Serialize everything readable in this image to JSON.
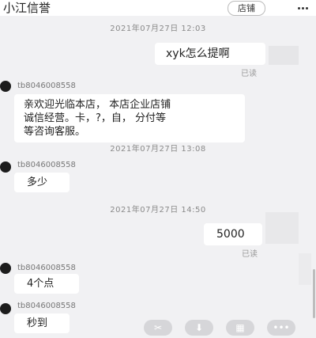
{
  "header": {
    "title": "小江信誉",
    "shop_label": "店铺",
    "more_icon": "more-dots-icon"
  },
  "messages": [
    {
      "type": "time",
      "text": "2021年07月27日 12:03"
    },
    {
      "type": "outgoing",
      "text": "xyk怎么提啊",
      "status": "已读"
    },
    {
      "type": "incoming",
      "user": "tb8046008558",
      "lines": [
        "亲欢迎光临本店， 本店企业店铺",
        "诚信经营。卡，?，自， 分付等",
        "等咨询客服。"
      ]
    },
    {
      "type": "time",
      "text": "2021年07月27日 13:08"
    },
    {
      "type": "incoming",
      "user": "tb8046008558",
      "lines": [
        "多少"
      ]
    },
    {
      "type": "time",
      "text": "2021年07月27日 14:50"
    },
    {
      "type": "outgoing",
      "text": "5000",
      "status": "已读"
    },
    {
      "type": "incoming",
      "user": "tb8046008558",
      "lines": [
        "4个点"
      ]
    },
    {
      "type": "incoming",
      "user": "tb8046008558",
      "lines": [
        "秒到"
      ]
    }
  ],
  "toolbar": {
    "icons": [
      "scissors-icon",
      "download-icon",
      "keyboard-icon",
      "more-icon"
    ]
  }
}
